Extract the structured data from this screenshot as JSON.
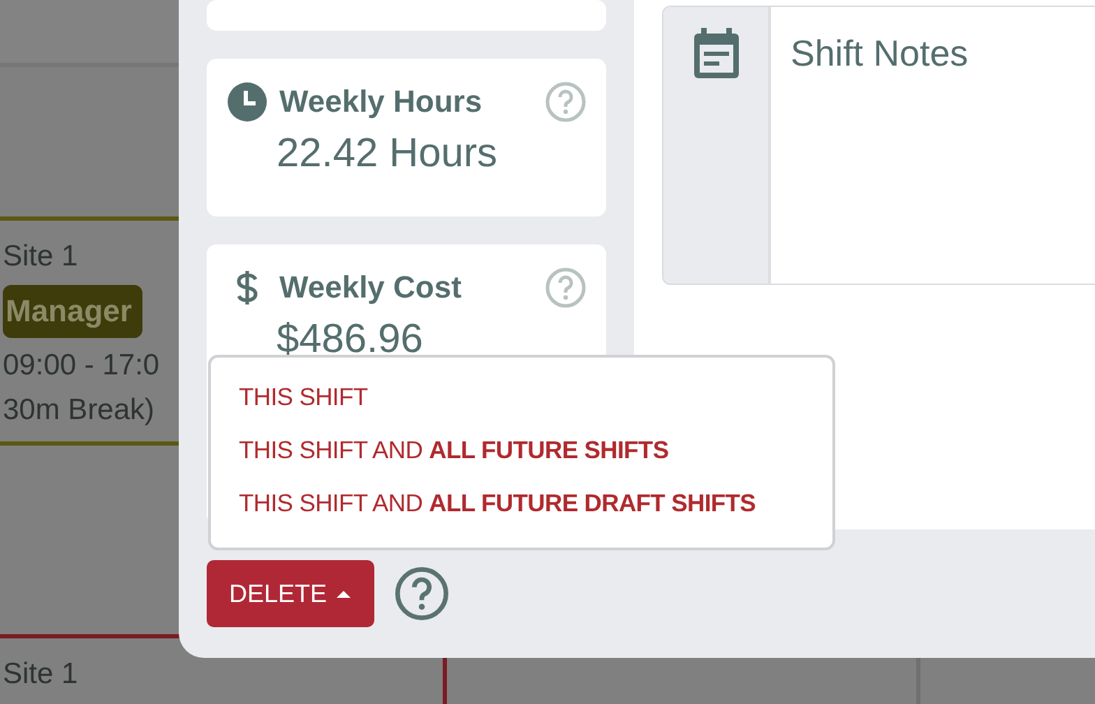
{
  "background_calendar": {
    "shifts": [
      {
        "site": "Site 1",
        "role": "Manager",
        "time": "09:00 - 17:0",
        "break": "30m Break)",
        "color": "#5c5812"
      },
      {
        "site": "Site 1",
        "color": "#7a1c22"
      }
    ]
  },
  "stats": [
    {
      "kind": "hours",
      "title": "Weekly Hours",
      "value": "22.42 Hours"
    },
    {
      "kind": "cost",
      "title": "Weekly Cost",
      "value": "$486.96"
    }
  ],
  "notes": {
    "placeholder": "Shift Notes"
  },
  "delete_menu": {
    "open": true,
    "items": [
      {
        "label": "THIS SHIFT"
      },
      {
        "label": "THIS SHIFT AND **ALL FUTURE SHIFTS**"
      },
      {
        "label": "THIS SHIFT AND **ALL FUTURE DRAFT SHIFTS**"
      }
    ]
  },
  "delete_button": {
    "label": "DELETE"
  }
}
